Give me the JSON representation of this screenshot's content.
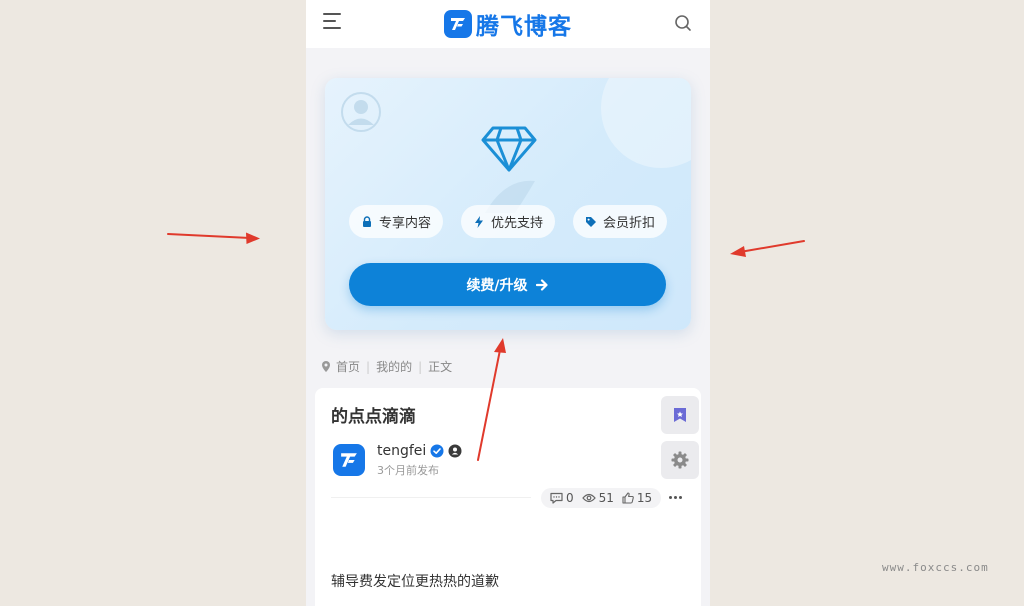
{
  "header": {
    "logo_text": "腾飞博客",
    "menu_icon": "menu-icon",
    "search_icon": "search-icon",
    "brand_color": "#1677e8"
  },
  "vip_card": {
    "perks": [
      {
        "label": "专享内容",
        "icon": "lock-icon"
      },
      {
        "label": "优先支持",
        "icon": "bolt-icon"
      },
      {
        "label": "会员折扣",
        "icon": "tag-icon"
      }
    ],
    "renew_label": "续费/升级",
    "accent": "#0d82d8"
  },
  "breadcrumb": {
    "items": [
      "首页",
      "我的的",
      "正文"
    ]
  },
  "article": {
    "title": "的点点滴滴",
    "author": "tengfei",
    "time": "3个月前发布",
    "stats": {
      "comments": "0",
      "views": "51",
      "likes": "15"
    },
    "body": "辅导费发定位更热热的道歉"
  },
  "watermark": "www.foxccs.com"
}
